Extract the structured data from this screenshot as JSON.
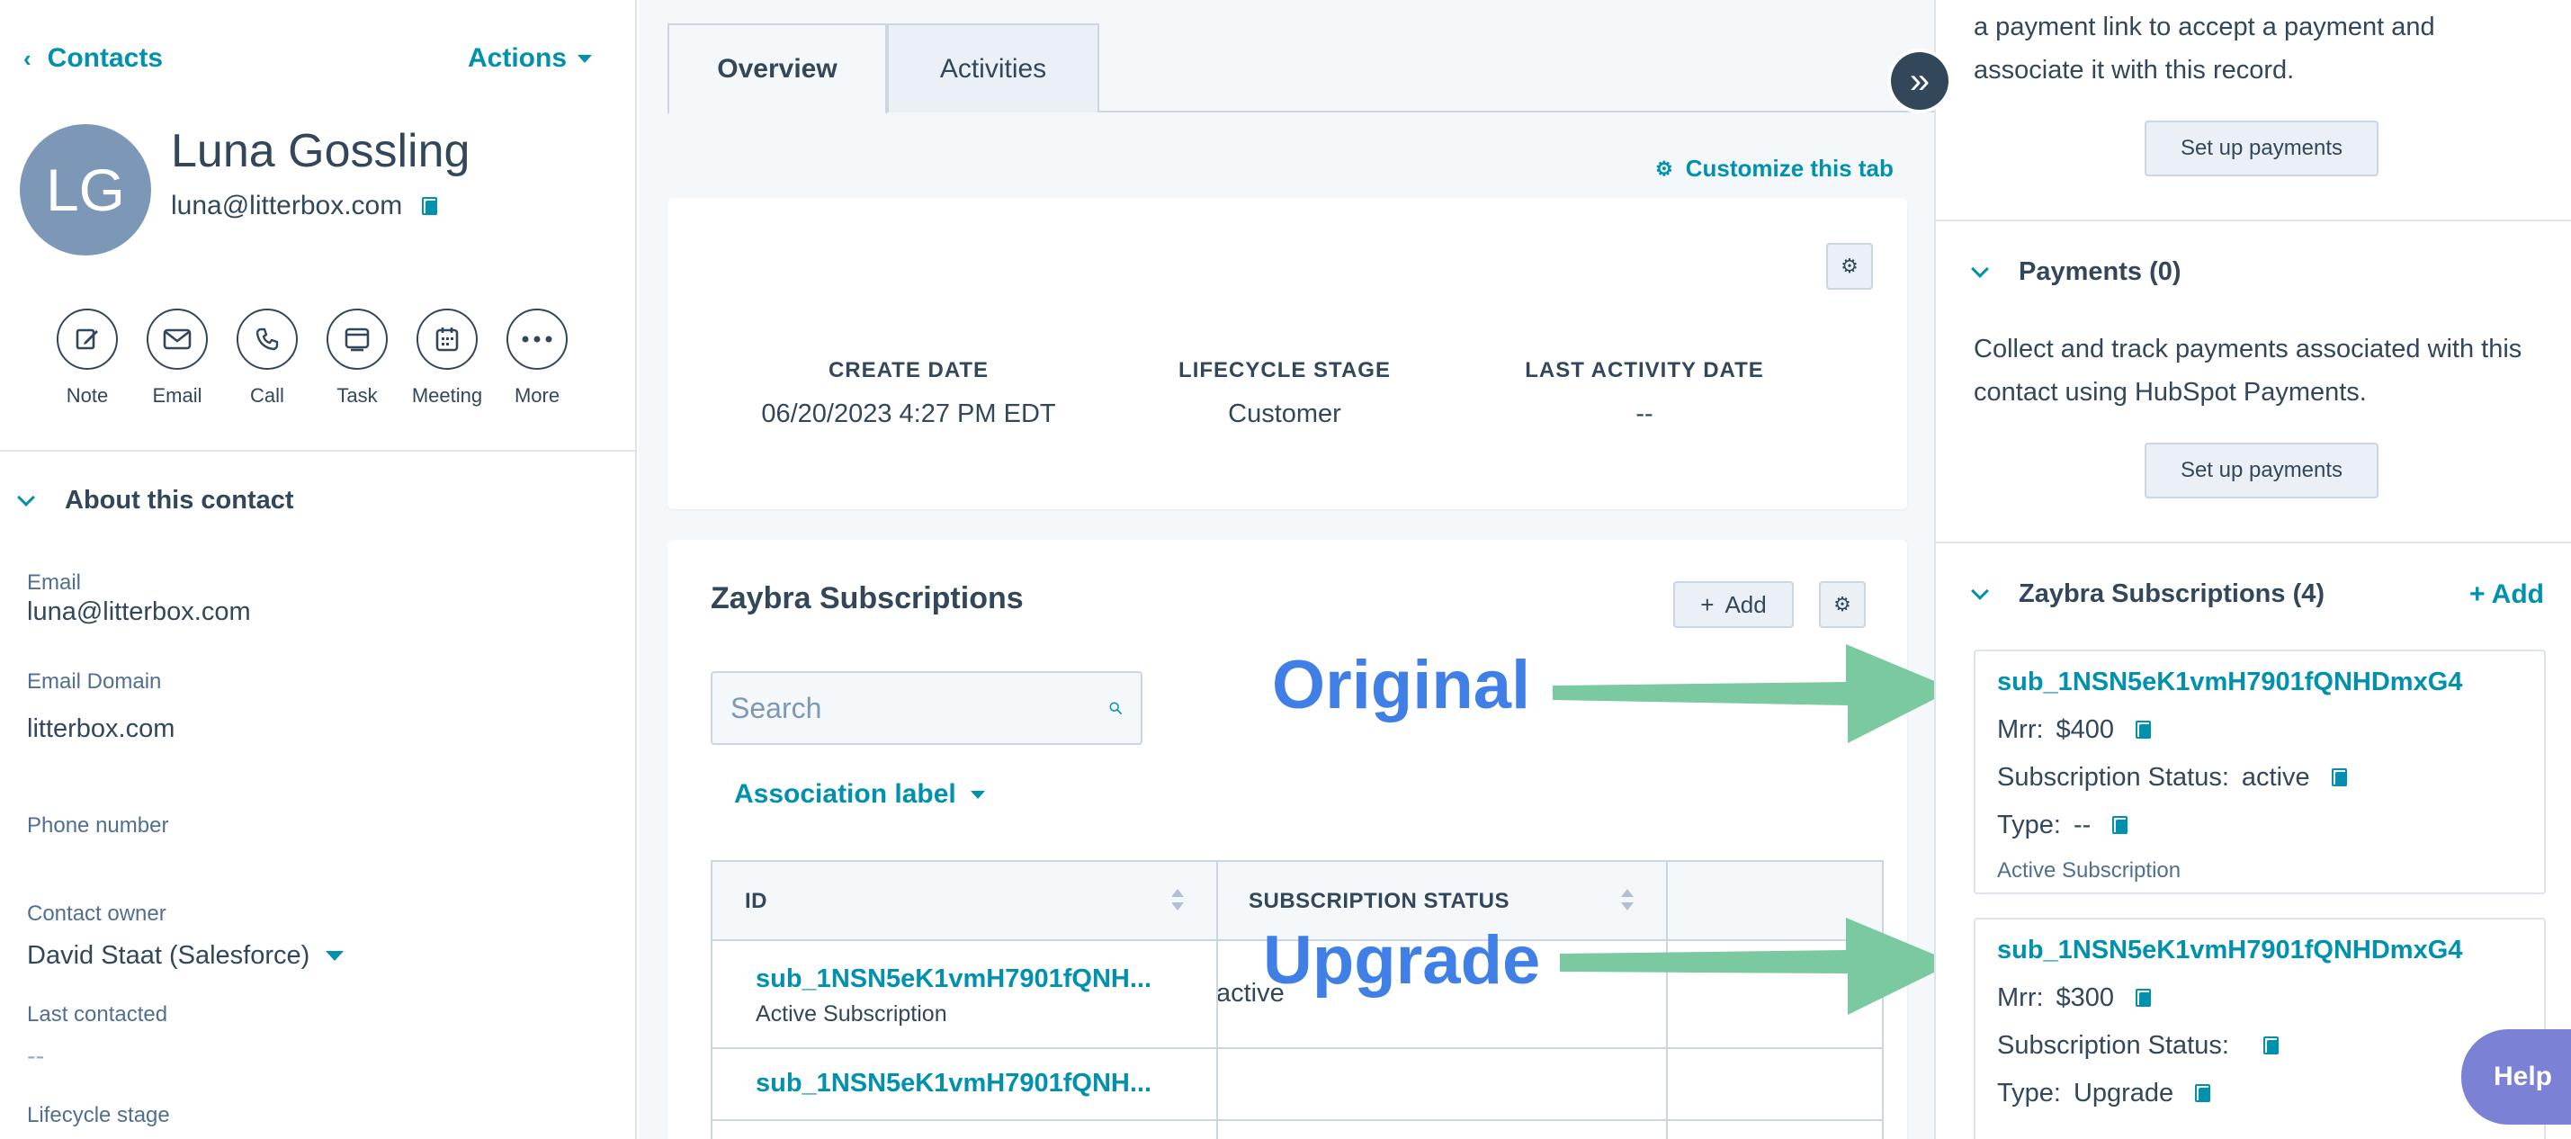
{
  "left": {
    "back_label": "Contacts",
    "actions_label": "Actions",
    "avatar_initials": "LG",
    "contact_name": "Luna Gossling",
    "contact_email": "luna@litterbox.com",
    "quick_actions": [
      {
        "label": "Note",
        "icon": "note-icon"
      },
      {
        "label": "Email",
        "icon": "email-icon"
      },
      {
        "label": "Call",
        "icon": "phone-icon"
      },
      {
        "label": "Task",
        "icon": "task-icon"
      },
      {
        "label": "Meeting",
        "icon": "calendar-icon"
      },
      {
        "label": "More",
        "icon": "more-icon"
      }
    ],
    "about_title": "About this contact",
    "properties": {
      "email_label": "Email",
      "email_value": "luna@litterbox.com",
      "domain_label": "Email Domain",
      "domain_value": "litterbox.com",
      "phone_label": "Phone number",
      "owner_label": "Contact owner",
      "owner_value": "David Staat (Salesforce)",
      "last_contacted_label": "Last contacted",
      "last_contacted_value": "--",
      "lifecycle_label": "Lifecycle stage"
    }
  },
  "middle": {
    "tabs": [
      {
        "label": "Overview",
        "active": true
      },
      {
        "label": "Activities",
        "active": false
      }
    ],
    "customize_label": "Customize this tab",
    "highlights": [
      {
        "header": "CREATE DATE",
        "value": "06/20/2023 4:27 PM EDT"
      },
      {
        "header": "LIFECYCLE STAGE",
        "value": "Customer"
      },
      {
        "header": "LAST ACTIVITY DATE",
        "value": "--"
      }
    ],
    "subscriptions_card": {
      "title": "Zaybra Subscriptions",
      "add_label": "Add",
      "search_placeholder": "Search",
      "association_label": "Association label",
      "columns": [
        "ID",
        "SUBSCRIPTION STATUS"
      ],
      "rows": [
        {
          "id": "sub_1NSN5eK1vmH7901fQNH...",
          "sub": "Active Subscription",
          "status": "active"
        },
        {
          "id": "sub_1NSN5eK1vmH7901fQNH...",
          "sub": "",
          "status": ""
        }
      ]
    },
    "annotations": {
      "original": "Original",
      "upgrade": "Upgrade",
      "arrow_color": "#7bc9a0",
      "text_color": "#3f7fe6"
    }
  },
  "right": {
    "payment_link_text": "a payment link to accept a payment and associate it with this record.",
    "setup_payments_label": "Set up payments",
    "payments_title": "Payments (0)",
    "payments_text": "Collect and track payments associated with this contact using HubSpot Payments.",
    "setup_payments_label_2": "Set up payments",
    "zs_title": "Zaybra Subscriptions (4)",
    "zs_add": "+ Add",
    "cards": [
      {
        "title": "sub_1NSN5eK1vmH7901fQNHDmxG4",
        "mrr_label": "Mrr:",
        "mrr_value": "$400",
        "status_label": "Subscription Status:",
        "status_value": "active",
        "type_label": "Type:",
        "type_value": "--",
        "footer": "Active Subscription"
      },
      {
        "title": "sub_1NSN5eK1vmH7901fQNHDmxG4",
        "mrr_label": "Mrr:",
        "mrr_value": "$300",
        "status_label": "Subscription Status:",
        "status_value": "",
        "type_label": "Type:",
        "type_value": "Upgrade"
      }
    ],
    "help_label": "Help"
  },
  "colors": {
    "link": "#0091ae",
    "text": "#33475b",
    "avatar_bg": "#7c98b6",
    "help_bg": "#7b82d6"
  }
}
